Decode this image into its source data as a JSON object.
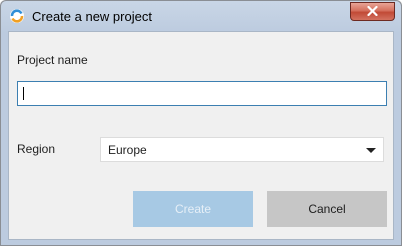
{
  "window": {
    "title": "Create a new project",
    "close_glyph": "✕"
  },
  "form": {
    "project_name_label": "Project name",
    "project_name_value": "",
    "region_label": "Region",
    "region_selected": "Europe"
  },
  "buttons": {
    "create_label": "Create",
    "cancel_label": "Cancel"
  },
  "colors": {
    "create_button_disabled": "#a7c9e4",
    "cancel_button": "#c6c6c6",
    "input_focus_border": "#3c7fb1",
    "close_button": "#c14a36"
  },
  "icons": {
    "app": "app-logo-icon",
    "close": "close-icon",
    "dropdown": "chevron-down-icon"
  }
}
